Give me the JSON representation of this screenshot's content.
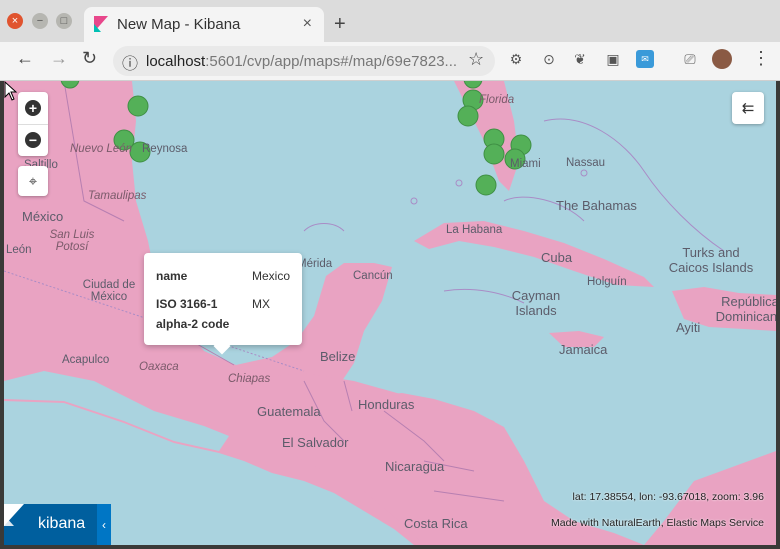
{
  "window": {
    "close_glyph": "×",
    "minimize_glyph": "−",
    "maximize_glyph": "□"
  },
  "tab": {
    "title": "New Map - Kibana",
    "close_glyph": "×",
    "new_tab_glyph": "+"
  },
  "toolbar": {
    "back_glyph": "←",
    "forward_glyph": "→",
    "reload_glyph": "↻",
    "info_glyph": "ⓘ",
    "url_host": "localhost",
    "url_path": ":5601/cvp/app/maps#/map/69e7823...",
    "bookmark_glyph": "☆",
    "menu_glyph": "⋮"
  },
  "map": {
    "countries": {
      "mexico": "México",
      "bahamas": "The Bahamas",
      "cuba": "Cuba",
      "belize": "Belize",
      "guatemala": "Guatemala",
      "honduras": "Honduras",
      "el_salvador": "El Salvador",
      "nicaragua": "Nicaragua",
      "costa_rica": "Costa Rica",
      "jamaica": "Jamaica",
      "turks_caicos": "Turks and Caicos Islands",
      "republica_dominicana": "República Dominicana",
      "haiti": "Ayiti",
      "cayman": "Cayman Islands"
    },
    "places": {
      "nuevo_leon": "Nuevo León",
      "saltillo": "Saltillo",
      "tamaulipas": "Tamaulipas",
      "leon": "León",
      "potosi": "San Luis Potosí",
      "ciudad_mexico": "Ciudad de México",
      "acapulco": "Acapulco",
      "oaxaca": "Oaxaca",
      "chiapas": "Chiapas",
      "merida": "Mérida",
      "cancun": "Cancún",
      "la_habana": "La Habana",
      "nassau": "Nassau",
      "holguin": "Holguín",
      "miami": "Miami",
      "florida": "Florida",
      "reynosa": "Reynosa"
    },
    "zoom_in": "+",
    "zoom_out": "−",
    "locate_glyph": "⌖",
    "layer_toggle_glyph": "⇇",
    "coords": "lat: 17.38554, lon: -93.67018, zoom: 3.96",
    "attribution": "Made with NaturalEarth, Elastic Maps Service",
    "colors": {
      "land": "#e9a3c2",
      "water": "#aad3df",
      "point": "#54b058",
      "border": "#a98cc6"
    }
  },
  "popup": {
    "name_key": "name",
    "name_value": "Mexico",
    "iso_key_line1": "ISO 3166-1",
    "iso_key_line2": "alpha-2 code",
    "iso_value": "MX"
  },
  "kibana": {
    "label": "kibana",
    "collapse_glyph": "‹"
  }
}
